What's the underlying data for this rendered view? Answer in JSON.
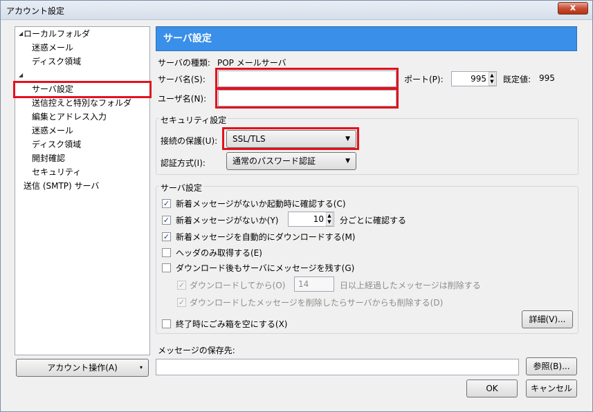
{
  "window": {
    "title": "アカウント設定",
    "close_label": "x"
  },
  "tree": {
    "items": [
      {
        "label": "ローカルフォルダ",
        "arrow": "◢"
      },
      {
        "label": "迷惑メール"
      },
      {
        "label": "ディスク領域"
      },
      {
        "label": "",
        "arrow": "◢"
      },
      {
        "label": "サーバ設定"
      },
      {
        "label": "送信控えと特別なフォルダ"
      },
      {
        "label": "編集とアドレス入力"
      },
      {
        "label": "迷惑メール"
      },
      {
        "label": "ディスク領域"
      },
      {
        "label": "開封確認"
      },
      {
        "label": "セキュリティ"
      },
      {
        "label": "送信 (SMTP) サーバ"
      }
    ]
  },
  "account_actions": {
    "label": "アカウント操作(A)",
    "arrow": "▾"
  },
  "panel": {
    "header": "サーバ設定",
    "server_type_label": "サーバの種類:",
    "server_type_value": "POP メールサーバ",
    "server_name_label": "サーバ名(S):",
    "server_name_value": "",
    "port_label": "ポート(P):",
    "port_value": "995",
    "default_label": "既定値:",
    "default_value": "995",
    "username_label": "ユーザ名(N):",
    "username_value": ""
  },
  "security": {
    "group_label": "セキュリティ設定",
    "connection_label": "接続の保護(U):",
    "connection_value": "SSL/TLS",
    "auth_label": "認証方式(I):",
    "auth_value": "通常のパスワード認証"
  },
  "server_settings": {
    "group_label": "サーバ設定",
    "check_on_startup": {
      "label": "新着メッセージがないか起動時に確認する(C)",
      "checked": true
    },
    "check_every": {
      "label": "新着メッセージがないか(Y)",
      "checked": true,
      "minutes": "10",
      "suffix": "分ごとに確認する"
    },
    "auto_download": {
      "label": "新着メッセージを自動的にダウンロードする(M)",
      "checked": true
    },
    "headers_only": {
      "label": "ヘッダのみ取得する(E)",
      "checked": false
    },
    "leave_on_server": {
      "label": "ダウンロード後もサーバにメッセージを残す(G)",
      "checked": false
    },
    "delete_after": {
      "label": "ダウンロードしてから(O)",
      "checked": true,
      "days": "14",
      "suffix": "日以上経過したメッセージは削除する"
    },
    "delete_when_deleted": {
      "label": "ダウンロードしたメッセージを削除したらサーバからも削除する(D)",
      "checked": true
    },
    "empty_trash": {
      "label": "終了時にごみ箱を空にする(X)",
      "checked": false
    },
    "advanced_button": "詳細(V)..."
  },
  "storage": {
    "label": "メッセージの保存先:",
    "path_value": "",
    "browse_button": "参照(B)..."
  },
  "footer": {
    "ok": "OK",
    "cancel": "キャンセル"
  },
  "icons": {
    "check": "✓",
    "dropdown": "▼"
  }
}
